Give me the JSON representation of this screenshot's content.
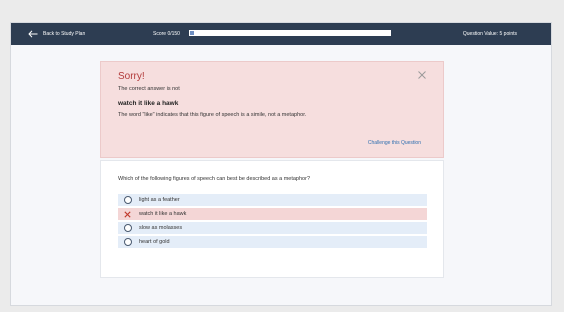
{
  "topbar": {
    "back_label": "Back to Study Plan",
    "score_label": "Score 0/150",
    "score_progress_fraction": 0.02,
    "question_value": "Question Value: 5 points"
  },
  "feedback": {
    "title": "Sorry!",
    "line1": "The correct answer is not",
    "answer": "watch it like a hawk",
    "explanation": "The word \"like\" indicates that this figure of speech is a simile, not a metaphor.",
    "challenge_label": "Challenge this Question"
  },
  "question": {
    "text": "Which of the following figures of speech can best be described as a metaphor?",
    "options": [
      {
        "label": "light as a feather",
        "state": "normal"
      },
      {
        "label": "watch it like a hawk",
        "state": "wrong"
      },
      {
        "label": "slow as molasses",
        "state": "normal"
      },
      {
        "label": "heart of gold",
        "state": "normal"
      }
    ]
  },
  "icons": {
    "back": "arrow-left-icon",
    "close": "close-icon",
    "wrong_mark": "x-mark-icon",
    "radio": "radio-circle-icon"
  },
  "colors": {
    "topbar_bg": "#2d3d52",
    "error_text": "#b23b3b",
    "error_bg": "#f6dede",
    "option_bg": "#e4edf8",
    "option_wrong_bg": "#f4d6d6",
    "link": "#2f6fb0"
  }
}
